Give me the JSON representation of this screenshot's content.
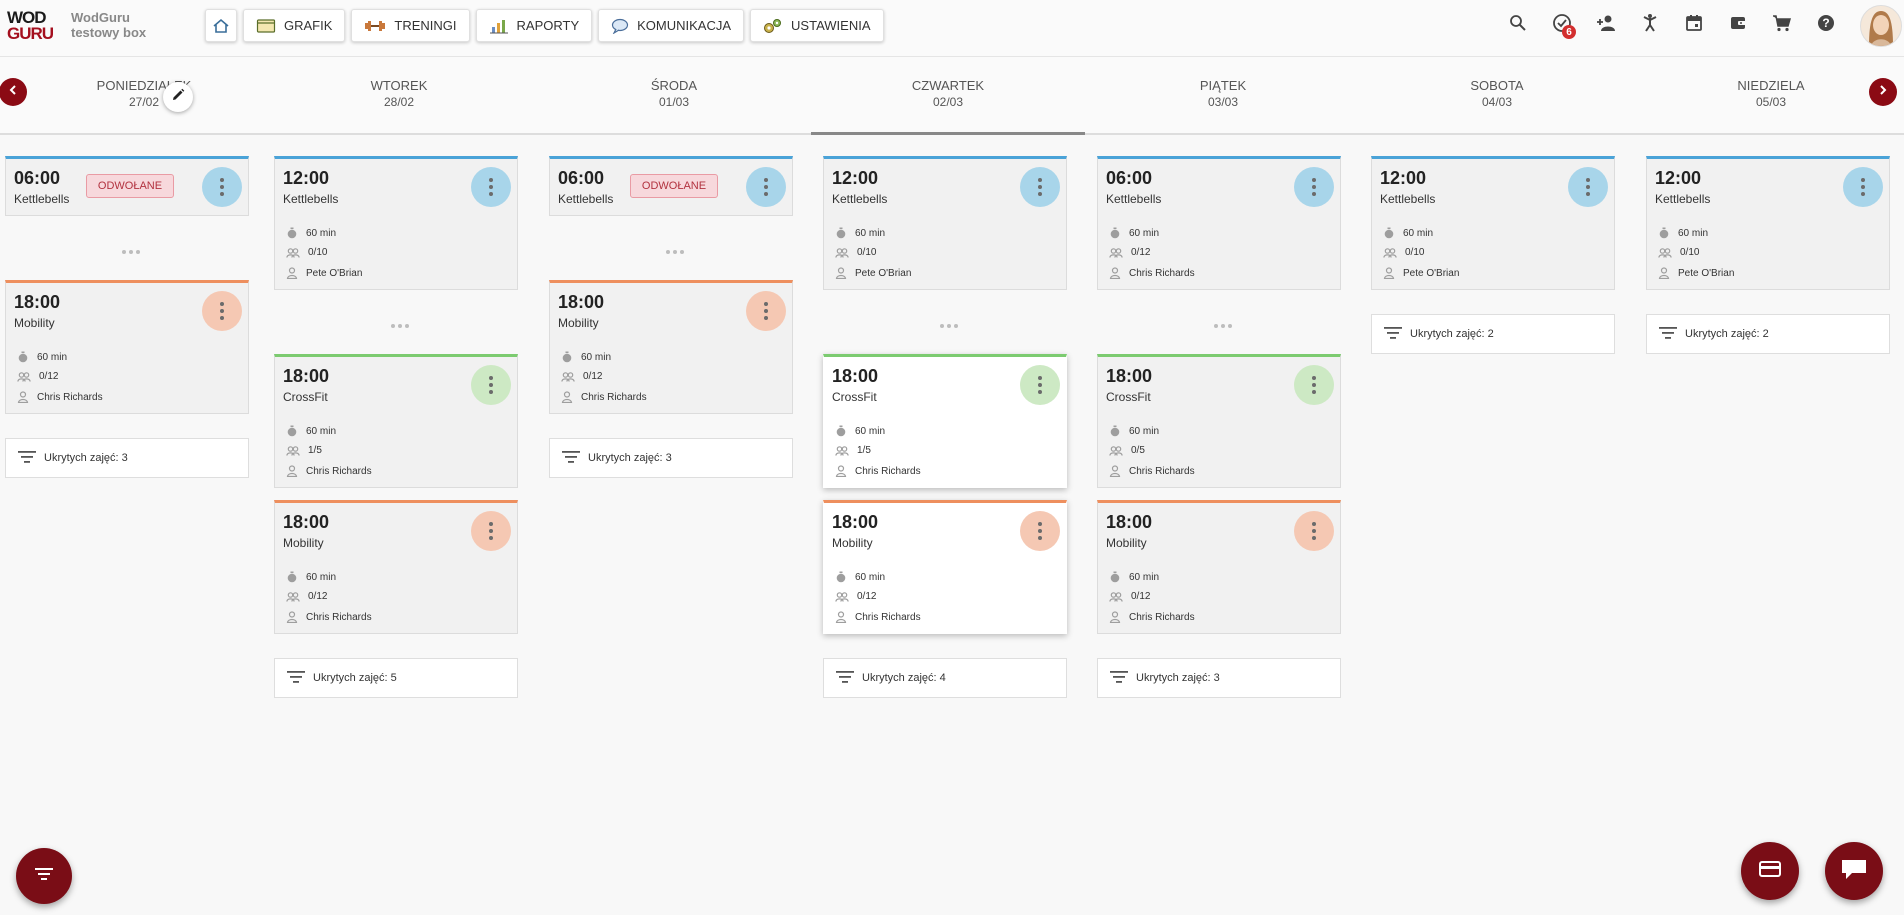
{
  "brand": {
    "logo_line1": "WOD",
    "logo_line2": "GURU",
    "box_name": "WodGuru testowy box"
  },
  "nav": {
    "schedule": "GRAFIK",
    "trainings": "TRENINGI",
    "reports": "RAPORTY",
    "communication": "KOMUNIKACJA",
    "settings": "USTAWIENIA"
  },
  "notifications": {
    "count": "6"
  },
  "days": [
    {
      "name": "PONIEDZIAŁEK",
      "date": "27/02"
    },
    {
      "name": "WTOREK",
      "date": "28/02"
    },
    {
      "name": "ŚRODA",
      "date": "01/03"
    },
    {
      "name": "CZWARTEK",
      "date": "02/03"
    },
    {
      "name": "PIĄTEK",
      "date": "03/03"
    },
    {
      "name": "SOBOTA",
      "date": "04/03"
    },
    {
      "name": "NIEDZIELA",
      "date": "05/03"
    }
  ],
  "schedule": [
    {
      "classes": [
        {
          "time": "06:00",
          "name": "Kettlebells",
          "color": "blue",
          "status": "ODWOŁANE"
        },
        {
          "time": "18:00",
          "name": "Mobility",
          "color": "orange",
          "duration": "60 min",
          "capacity": "0/12",
          "coach": "Chris Richards"
        }
      ],
      "hidden": "Ukrytych zajęć: 3"
    },
    {
      "classes": [
        {
          "time": "12:00",
          "name": "Kettlebells",
          "color": "blue",
          "duration": "60 min",
          "capacity": "0/10",
          "coach": "Pete O'Brian"
        },
        {
          "time": "18:00",
          "name": "CrossFit",
          "color": "green",
          "duration": "60 min",
          "capacity": "1/5",
          "coach": "Chris Richards"
        },
        {
          "time": "18:00",
          "name": "Mobility",
          "color": "orange",
          "duration": "60 min",
          "capacity": "0/12",
          "coach": "Chris Richards"
        }
      ],
      "hidden": "Ukrytych zajęć: 5"
    },
    {
      "classes": [
        {
          "time": "06:00",
          "name": "Kettlebells",
          "color": "blue",
          "status": "ODWOŁANE"
        },
        {
          "time": "18:00",
          "name": "Mobility",
          "color": "orange",
          "duration": "60 min",
          "capacity": "0/12",
          "coach": "Chris Richards"
        }
      ],
      "hidden": "Ukrytych zajęć: 3"
    },
    {
      "classes": [
        {
          "time": "12:00",
          "name": "Kettlebells",
          "color": "blue",
          "duration": "60 min",
          "capacity": "0/10",
          "coach": "Pete O'Brian"
        },
        {
          "time": "18:00",
          "name": "CrossFit",
          "color": "green",
          "duration": "60 min",
          "capacity": "1/5",
          "coach": "Chris Richards"
        },
        {
          "time": "18:00",
          "name": "Mobility",
          "color": "orange",
          "duration": "60 min",
          "capacity": "0/12",
          "coach": "Chris Richards"
        }
      ],
      "hidden": "Ukrytych zajęć: 4"
    },
    {
      "classes": [
        {
          "time": "06:00",
          "name": "Kettlebells",
          "color": "blue",
          "duration": "60 min",
          "capacity": "0/12",
          "coach": "Chris Richards"
        },
        {
          "time": "18:00",
          "name": "CrossFit",
          "color": "green",
          "duration": "60 min",
          "capacity": "0/5",
          "coach": "Chris Richards"
        },
        {
          "time": "18:00",
          "name": "Mobility",
          "color": "orange",
          "duration": "60 min",
          "capacity": "0/12",
          "coach": "Chris Richards"
        }
      ],
      "hidden": "Ukrytych zajęć: 3"
    },
    {
      "classes": [
        {
          "time": "12:00",
          "name": "Kettlebells",
          "color": "blue",
          "duration": "60 min",
          "capacity": "0/10",
          "coach": "Pete O'Brian"
        }
      ],
      "hidden": "Ukrytych zajęć: 2"
    },
    {
      "classes": [
        {
          "time": "12:00",
          "name": "Kettlebells",
          "color": "blue",
          "duration": "60 min",
          "capacity": "0/10",
          "coach": "Pete O'Brian"
        }
      ],
      "hidden": "Ukrytych zajęć: 2"
    }
  ],
  "colors": {
    "blue": "#4aa3d8",
    "orange": "#ee8f5e",
    "green": "#7ccb70",
    "brand": "#8b0a14",
    "cancelled": "#b2323f"
  }
}
